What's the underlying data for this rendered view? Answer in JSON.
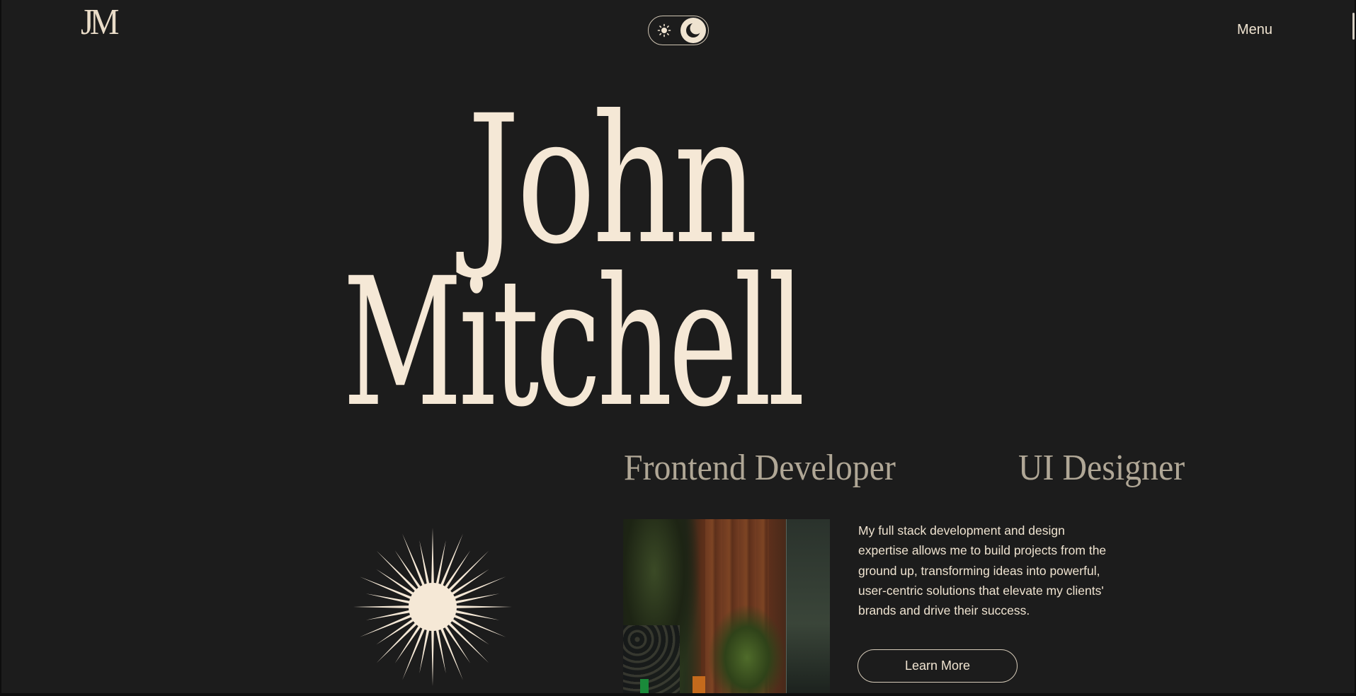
{
  "header": {
    "logo_text": "JM",
    "menu_label": "Menu",
    "theme_toggle": {
      "light_icon": "sun-icon",
      "dark_icon": "moon-icon",
      "active": "dark"
    }
  },
  "hero": {
    "first_name": "John",
    "last_name": "Mitchell",
    "roles": [
      "Frontend Developer",
      "UI Designer"
    ]
  },
  "intro": {
    "decoration_icon": "starburst-icon",
    "photo_label": "interior-photo",
    "bio": "My full stack development and design expertise allows me to build projects from the ground up, transforming ideas into powerful, user-centric solutions that elevate my clients' brands and drive their success.",
    "cta_label": "Learn More"
  },
  "colors": {
    "background": "#1c1c1c",
    "cream": "#f5e8d6",
    "muted": "#b0a796"
  }
}
